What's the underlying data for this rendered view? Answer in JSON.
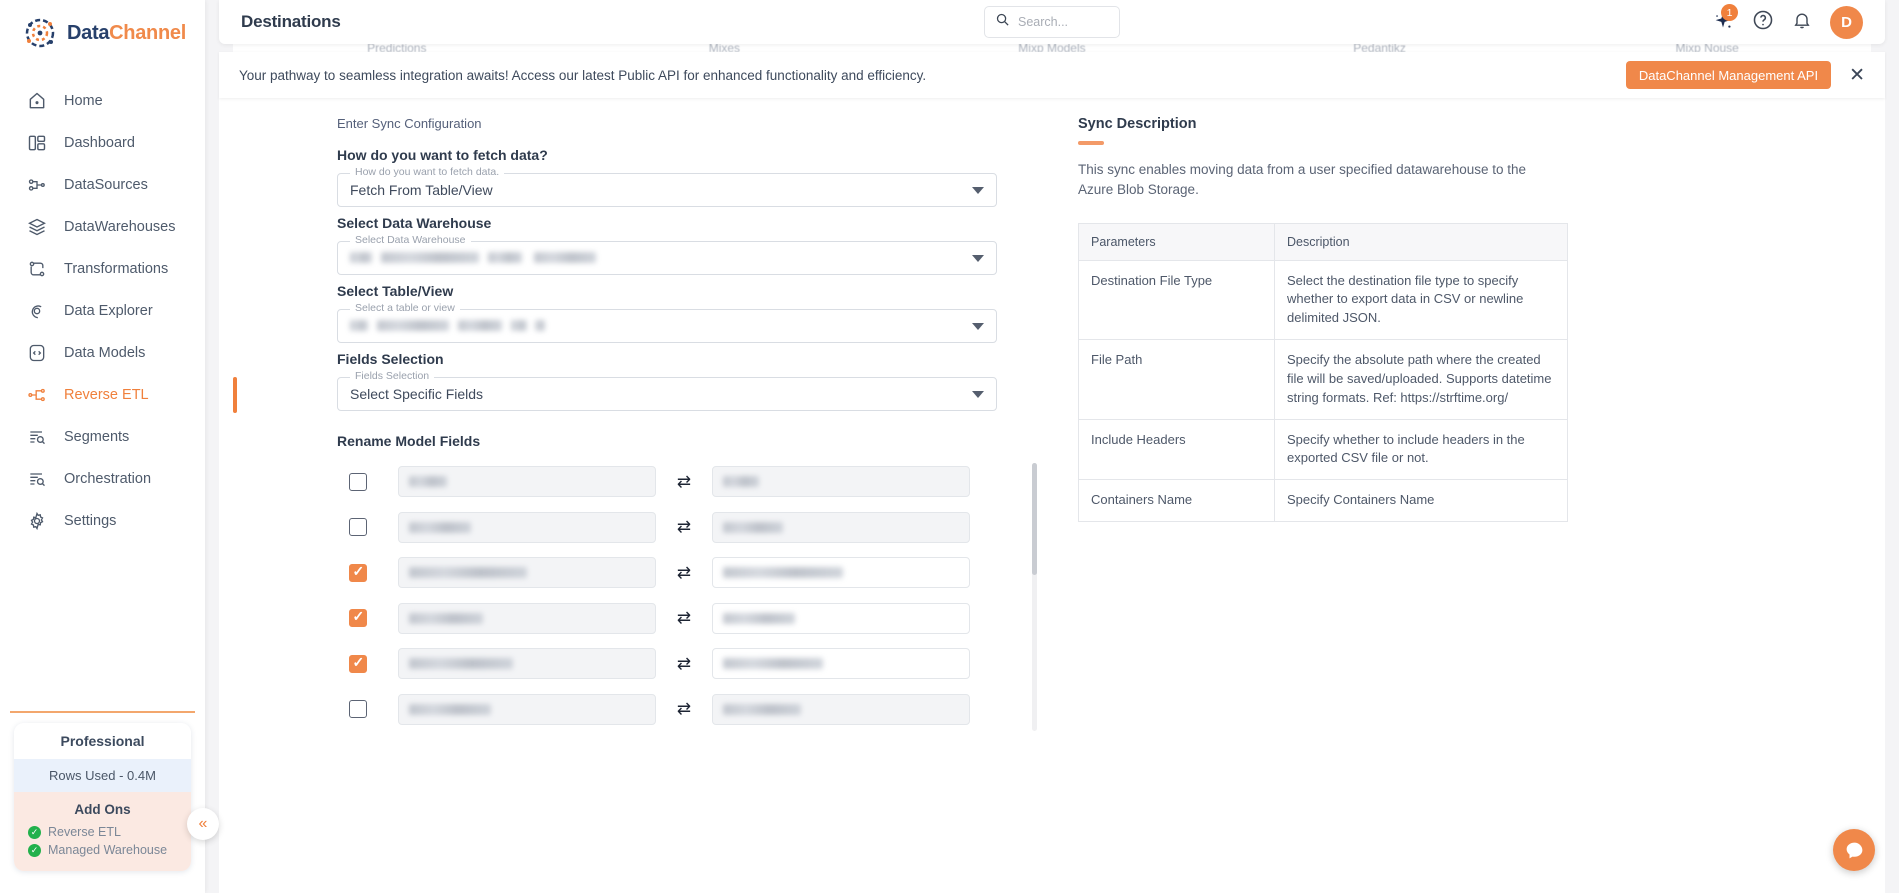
{
  "brand": {
    "name_part1": "Data",
    "name_part2": "Channel"
  },
  "sidebar": {
    "items": [
      {
        "label": "Home",
        "icon": "home-icon",
        "active": false
      },
      {
        "label": "Dashboard",
        "icon": "dashboard-icon",
        "active": false
      },
      {
        "label": "DataSources",
        "icon": "datasources-icon",
        "active": false
      },
      {
        "label": "DataWarehouses",
        "icon": "datawarehouses-icon",
        "active": false
      },
      {
        "label": "Transformations",
        "icon": "transformations-icon",
        "active": false
      },
      {
        "label": "Data Explorer",
        "icon": "data-explorer-icon",
        "active": false
      },
      {
        "label": "Data Models",
        "icon": "data-models-icon",
        "active": false
      },
      {
        "label": "Reverse ETL",
        "icon": "reverse-etl-icon",
        "active": true
      },
      {
        "label": "Segments",
        "icon": "segments-icon",
        "active": false
      },
      {
        "label": "Orchestration",
        "icon": "orchestration-icon",
        "active": false
      },
      {
        "label": "Settings",
        "icon": "gear-icon",
        "active": false
      }
    ],
    "plan": {
      "name": "Professional",
      "rows_used": "Rows Used - 0.4M",
      "addons_title": "Add Ons",
      "addons": [
        "Reverse ETL",
        "Managed Warehouse"
      ]
    },
    "collapse_label": "«"
  },
  "header": {
    "title": "Destinations",
    "search_placeholder": "Search...",
    "notification_badge": "1",
    "avatar_initial": "D"
  },
  "tabs": [
    "Predictions",
    "Mixes",
    "Mixp Models",
    "Pedantikz",
    "Mixp Nouse"
  ],
  "banner": {
    "message": "Your pathway to seamless integration awaits! Access our latest Public API for enhanced functionality and efficiency.",
    "cta_label": "DataChannel Management API",
    "close_label": "✕"
  },
  "form": {
    "section_label": "Enter Sync Configuration",
    "fields": [
      {
        "title": "How do you want to fetch data?",
        "legend": "How do you want to fetch data.",
        "value": "Fetch From Table/View",
        "redacted": false
      },
      {
        "title": "Select Data Warehouse",
        "legend": "Select Data Warehouse",
        "value": "",
        "redacted": true,
        "redact_widths": [
          22,
          98,
          34,
          62
        ]
      },
      {
        "title": "Select Table/View",
        "legend": "Select a table or view",
        "value": "",
        "redacted": true,
        "redact_widths": [
          18,
          72,
          44,
          16,
          10
        ]
      },
      {
        "title": "Fields Selection",
        "legend": "Fields Selection",
        "value": "Select Specific Fields",
        "redacted": false
      }
    ],
    "rename_title": "Rename Model Fields",
    "rename_rows": [
      {
        "checked": false,
        "source_width": 38,
        "target_width": 36
      },
      {
        "checked": false,
        "source_width": 62,
        "target_width": 60
      },
      {
        "checked": true,
        "source_width": 118,
        "target_width": 120
      },
      {
        "checked": true,
        "source_width": 74,
        "target_width": 72
      },
      {
        "checked": true,
        "source_width": 104,
        "target_width": 100
      },
      {
        "checked": false,
        "source_width": 82,
        "target_width": 78
      },
      {
        "checked": false,
        "source_width": 66,
        "target_width": 64
      }
    ]
  },
  "sync": {
    "title": "Sync Description",
    "description": "This sync enables moving data from a user specified datawarehouse to the Azure Blob Storage.",
    "table": {
      "headers": [
        "Parameters",
        "Description"
      ],
      "rows": [
        {
          "parameter": "Destination File Type",
          "description": "Select the destination file type to specify whether to export data in CSV or newline delimited JSON."
        },
        {
          "parameter": "File Path",
          "description": "Specify the absolute path where the created file will be saved/uploaded. Supports datetime string formats. Ref: https://strftime.org/"
        },
        {
          "parameter": "Include Headers",
          "description": "Specify whether to include headers in the exported CSV file or not."
        },
        {
          "parameter": "Containers Name",
          "description": "Specify Containers Name"
        }
      ]
    }
  },
  "colors": {
    "accent": "#f0884a",
    "navy": "#27406b",
    "active_nav": "#f0803c",
    "plan_rows_bg": "#eaf1fb",
    "plan_addons_bg": "#fbe9e2"
  }
}
